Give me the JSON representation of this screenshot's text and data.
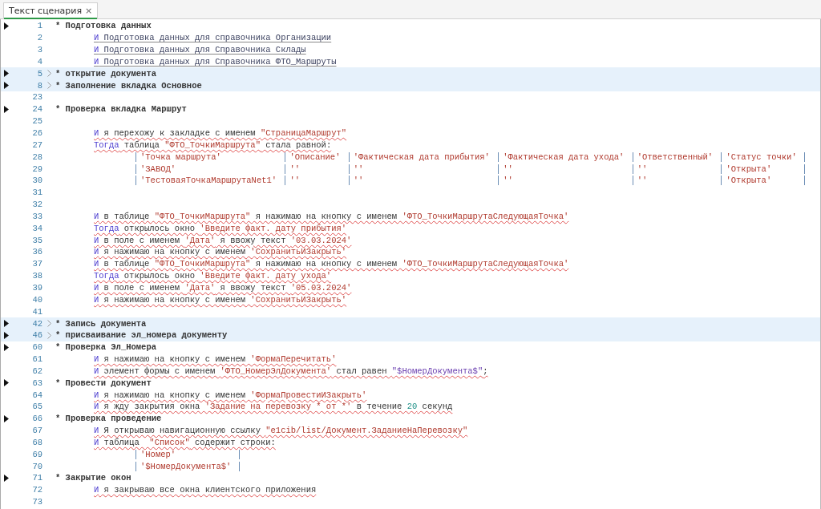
{
  "tabs": [
    {
      "label": "Текст сценария",
      "close": "×",
      "selected": true
    }
  ],
  "lines": [
    {
      "number": "1",
      "kind": "section",
      "collapsed": false,
      "tokens": [
        {
          "kind": "text",
          "text": "* Подготовка данных"
        }
      ]
    },
    {
      "number": "2",
      "kind": "call_step",
      "tokens": [
        {
          "kind": "keyword",
          "text": "И"
        },
        {
          "kind": "call",
          "text": " Подготовка данных для справочника Организации"
        }
      ]
    },
    {
      "number": "3",
      "kind": "call_step",
      "tokens": [
        {
          "kind": "keyword",
          "text": "И"
        },
        {
          "kind": "call",
          "text": " Подготовка данных для Справочника Склады"
        }
      ]
    },
    {
      "number": "4",
      "kind": "call_step",
      "tokens": [
        {
          "kind": "keyword",
          "text": "И"
        },
        {
          "kind": "call",
          "text": " Подготовка данных для Справочника ФТО_Маршруты"
        }
      ]
    },
    {
      "number": "5",
      "kind": "section",
      "collapsed": true,
      "tokens": [
        {
          "kind": "text",
          "text": "* открытие документа"
        }
      ]
    },
    {
      "number": "8",
      "kind": "section",
      "collapsed": true,
      "tokens": [
        {
          "kind": "text",
          "text": "* Заполнение вкладка Основное"
        }
      ]
    },
    {
      "number": "23",
      "kind": "blank"
    },
    {
      "number": "24",
      "kind": "section",
      "collapsed": false,
      "tokens": [
        {
          "kind": "text",
          "text": "* Проверка вкладка Маршрут"
        }
      ]
    },
    {
      "number": "25",
      "kind": "blank"
    },
    {
      "number": "26",
      "kind": "step",
      "tokens": [
        {
          "kind": "keyword",
          "text": "И"
        },
        {
          "kind": "text",
          "text": " я перехожу к закладке с именем "
        },
        {
          "kind": "string",
          "text": "\"СтраницаМаршрут\""
        }
      ]
    },
    {
      "number": "27",
      "kind": "step",
      "tokens": [
        {
          "kind": "keyword",
          "text": "Тогда"
        },
        {
          "kind": "text",
          "text": " таблица "
        },
        {
          "kind": "string",
          "text": "\"ФТО_ТочкиМаршрута\""
        },
        {
          "kind": "text",
          "text": " стала равной:"
        }
      ]
    },
    {
      "number": "28",
      "kind": "table_row",
      "cells": [
        "'Точка маршрута'",
        "'Описание'",
        "'Фактическая дата прибытия'",
        "'Фактическая дата ухода'",
        "'Ответственный'",
        "'Статус точки'"
      ]
    },
    {
      "number": "29",
      "kind": "table_row",
      "cells": [
        "'ЗАВОД'",
        "''",
        "''",
        "''",
        "''",
        "'Открыта'"
      ]
    },
    {
      "number": "30",
      "kind": "table_row",
      "cells": [
        "'ТестоваяТочкаМаршрутаNet1'",
        "''",
        "''",
        "''",
        "''",
        "'Открыта'"
      ]
    },
    {
      "number": "31",
      "kind": "blank"
    },
    {
      "number": "32",
      "kind": "blank"
    },
    {
      "number": "33",
      "kind": "step",
      "tokens": [
        {
          "kind": "keyword",
          "text": "И"
        },
        {
          "kind": "text",
          "text": " в таблице "
        },
        {
          "kind": "string",
          "text": "\"ФТО_ТочкиМаршрута\""
        },
        {
          "kind": "text",
          "text": " я нажимаю на кнопку с именем "
        },
        {
          "kind": "string",
          "text": "'ФТО_ТочкиМаршрутаСледующаяТочка'"
        }
      ]
    },
    {
      "number": "34",
      "kind": "step",
      "tokens": [
        {
          "kind": "keyword",
          "text": "Тогда"
        },
        {
          "kind": "text",
          "text": " открылось окно "
        },
        {
          "kind": "string",
          "text": "'Введите факт. дату прибытия'"
        }
      ]
    },
    {
      "number": "35",
      "kind": "step",
      "tokens": [
        {
          "kind": "keyword",
          "text": "И"
        },
        {
          "kind": "text",
          "text": " в поле с именем "
        },
        {
          "kind": "string",
          "text": "'Дата'"
        },
        {
          "kind": "text",
          "text": " я ввожу текст "
        },
        {
          "kind": "string",
          "text": "'03.03.2024'"
        }
      ]
    },
    {
      "number": "36",
      "kind": "step",
      "tokens": [
        {
          "kind": "keyword",
          "text": "И"
        },
        {
          "kind": "text",
          "text": " я нажимаю на кнопку с именем "
        },
        {
          "kind": "string",
          "text": "'СохранитьИЗакрыть'"
        }
      ]
    },
    {
      "number": "37",
      "kind": "step",
      "tokens": [
        {
          "kind": "keyword",
          "text": "И"
        },
        {
          "kind": "text",
          "text": " в таблице "
        },
        {
          "kind": "string",
          "text": "\"ФТО_ТочкиМаршрута\""
        },
        {
          "kind": "text",
          "text": " я нажимаю на кнопку с именем "
        },
        {
          "kind": "string",
          "text": "'ФТО_ТочкиМаршрутаСледующаяТочка'"
        }
      ]
    },
    {
      "number": "38",
      "kind": "step",
      "tokens": [
        {
          "kind": "keyword",
          "text": "Тогда"
        },
        {
          "kind": "text",
          "text": " открылось окно "
        },
        {
          "kind": "string",
          "text": "'Введите факт. дату ухода'"
        }
      ]
    },
    {
      "number": "39",
      "kind": "step",
      "tokens": [
        {
          "kind": "keyword",
          "text": "И"
        },
        {
          "kind": "text",
          "text": " в поле с именем "
        },
        {
          "kind": "string",
          "text": "'Дата'"
        },
        {
          "kind": "text",
          "text": " я ввожу текст "
        },
        {
          "kind": "string",
          "text": "'05.03.2024'"
        }
      ]
    },
    {
      "number": "40",
      "kind": "step",
      "tokens": [
        {
          "kind": "keyword",
          "text": "И"
        },
        {
          "kind": "text",
          "text": " я нажимаю на кнопку с именем "
        },
        {
          "kind": "string",
          "text": "'СохранитьИЗакрыть'"
        }
      ]
    },
    {
      "number": "41",
      "kind": "blank"
    },
    {
      "number": "42",
      "kind": "section",
      "collapsed": true,
      "tokens": [
        {
          "kind": "text",
          "text": "* Запись документа"
        }
      ]
    },
    {
      "number": "46",
      "kind": "section",
      "collapsed": true,
      "tokens": [
        {
          "kind": "text",
          "text": "* присваивание эл_номера документу"
        }
      ]
    },
    {
      "number": "60",
      "kind": "section",
      "collapsed": false,
      "tokens": [
        {
          "kind": "text",
          "text": "* Проверка Эл_Номера"
        }
      ]
    },
    {
      "number": "61",
      "kind": "step",
      "tokens": [
        {
          "kind": "keyword",
          "text": "И"
        },
        {
          "kind": "text",
          "text": " я нажимаю на кнопку с именем "
        },
        {
          "kind": "string",
          "text": "'ФормаПеречитать'"
        }
      ]
    },
    {
      "number": "62",
      "kind": "step",
      "tokens": [
        {
          "kind": "keyword",
          "text": "И"
        },
        {
          "kind": "text",
          "text": " элемент формы с именем "
        },
        {
          "kind": "string",
          "text": "'ФТО_НомерЭлДокумента'"
        },
        {
          "kind": "text",
          "text": " стал равен "
        },
        {
          "kind": "variable",
          "text": "\"$НомерДокумента$\""
        },
        {
          "kind": "text",
          "text": ";"
        }
      ]
    },
    {
      "number": "63",
      "kind": "section",
      "collapsed": false,
      "tokens": [
        {
          "kind": "text",
          "text": "* Провести документ"
        }
      ]
    },
    {
      "number": "64",
      "kind": "step",
      "tokens": [
        {
          "kind": "keyword",
          "text": "И"
        },
        {
          "kind": "text",
          "text": " я нажимаю на кнопку с именем "
        },
        {
          "kind": "string",
          "text": "'ФормаПровестиИЗакрыть'"
        }
      ]
    },
    {
      "number": "65",
      "kind": "step",
      "tokens": [
        {
          "kind": "keyword",
          "text": "И"
        },
        {
          "kind": "text",
          "text": " я жду закрытия окна "
        },
        {
          "kind": "string",
          "text": "'Задание на перевозку * от *'"
        },
        {
          "kind": "text",
          "text": " в течение "
        },
        {
          "kind": "number",
          "text": "20"
        },
        {
          "kind": "text",
          "text": " секунд"
        }
      ]
    },
    {
      "number": "66",
      "kind": "section",
      "collapsed": false,
      "tokens": [
        {
          "kind": "text",
          "text": "* Проверка проведение"
        }
      ]
    },
    {
      "number": "67",
      "kind": "step",
      "tokens": [
        {
          "kind": "keyword",
          "text": "И"
        },
        {
          "kind": "text",
          "text": " Я открываю навигационную ссылку "
        },
        {
          "kind": "string",
          "text": "\"e1cib/list/Документ.ЗаданиеНаПеревозку\""
        }
      ]
    },
    {
      "number": "68",
      "kind": "step",
      "tokens": [
        {
          "kind": "keyword",
          "text": "И"
        },
        {
          "kind": "text",
          "text": " таблица  "
        },
        {
          "kind": "string",
          "text": "\"Список\""
        },
        {
          "kind": "text",
          "text": " содержит строки:"
        }
      ]
    },
    {
      "number": "69",
      "kind": "table_row",
      "cells": [
        "'Номер'"
      ]
    },
    {
      "number": "70",
      "kind": "table_row",
      "cells": [
        "'$НомерДокумента$'"
      ]
    },
    {
      "number": "71",
      "kind": "section",
      "collapsed": false,
      "tokens": [
        {
          "kind": "text",
          "text": "* Закрытие окон"
        }
      ]
    },
    {
      "number": "72",
      "kind": "step",
      "tokens": [
        {
          "kind": "keyword",
          "text": "И"
        },
        {
          "kind": "text",
          "text": " я закрываю все окна клиентского приложения"
        }
      ]
    },
    {
      "number": "73",
      "kind": "blank"
    }
  ]
}
